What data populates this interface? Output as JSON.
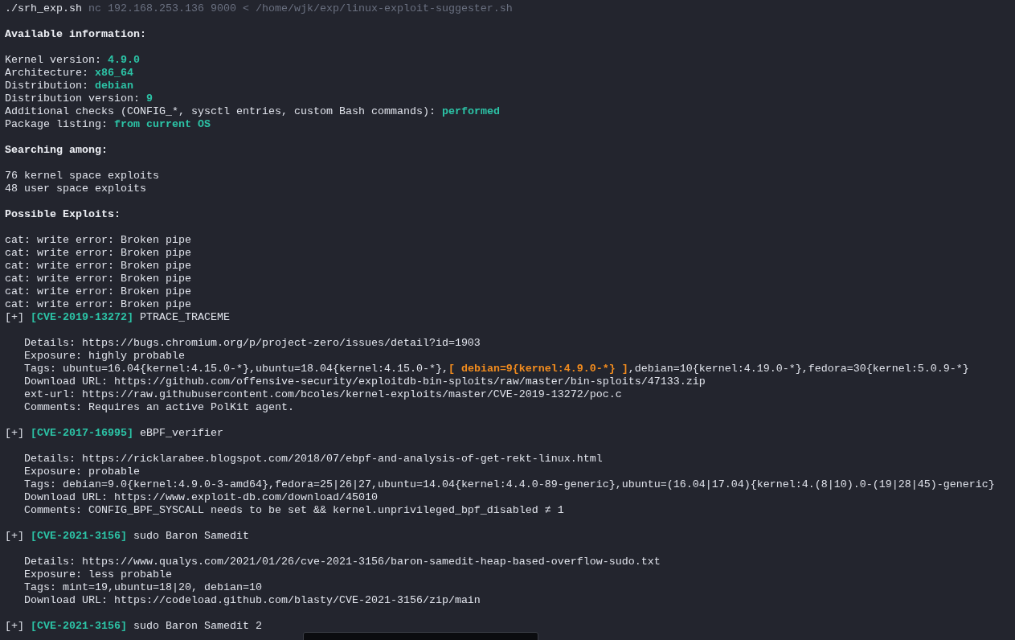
{
  "terminal": {
    "lines": [
      {
        "kind": "text",
        "segments": [
          {
            "kind": "plain",
            "text": "./srh_exp.sh"
          },
          {
            "kind": "ghost",
            "text": " nc 192.168.253.136 9000 < /home/wjk/exp/linux-exploit-suggester.sh"
          }
        ]
      },
      {
        "kind": "blank"
      },
      {
        "kind": "text",
        "segments": [
          {
            "kind": "bold",
            "text": "Available information:"
          }
        ]
      },
      {
        "kind": "blank"
      },
      {
        "kind": "text",
        "segments": [
          {
            "kind": "plain",
            "text": "Kernel version: "
          },
          {
            "kind": "accent",
            "text": "4.9.0"
          }
        ]
      },
      {
        "kind": "text",
        "segments": [
          {
            "kind": "plain",
            "text": "Architecture: "
          },
          {
            "kind": "accent",
            "text": "x86_64"
          }
        ]
      },
      {
        "kind": "text",
        "segments": [
          {
            "kind": "plain",
            "text": "Distribution: "
          },
          {
            "kind": "accent",
            "text": "debian"
          }
        ]
      },
      {
        "kind": "text",
        "segments": [
          {
            "kind": "plain",
            "text": "Distribution version: "
          },
          {
            "kind": "accent",
            "text": "9"
          }
        ]
      },
      {
        "kind": "text",
        "segments": [
          {
            "kind": "plain",
            "text": "Additional checks (CONFIG_*, sysctl entries, custom Bash commands): "
          },
          {
            "kind": "accent",
            "text": "performed"
          }
        ]
      },
      {
        "kind": "text",
        "segments": [
          {
            "kind": "plain",
            "text": "Package listing: "
          },
          {
            "kind": "accent",
            "text": "from current OS"
          }
        ]
      },
      {
        "kind": "blank"
      },
      {
        "kind": "text",
        "segments": [
          {
            "kind": "bold",
            "text": "Searching among:"
          }
        ]
      },
      {
        "kind": "blank"
      },
      {
        "kind": "text",
        "segments": [
          {
            "kind": "plain",
            "text": "76 kernel space exploits"
          }
        ]
      },
      {
        "kind": "text",
        "segments": [
          {
            "kind": "plain",
            "text": "48 user space exploits"
          }
        ]
      },
      {
        "kind": "blank"
      },
      {
        "kind": "text",
        "segments": [
          {
            "kind": "bold",
            "text": "Possible Exploits:"
          }
        ]
      },
      {
        "kind": "blank"
      },
      {
        "kind": "text",
        "segments": [
          {
            "kind": "plain",
            "text": "cat: write error: Broken pipe"
          }
        ]
      },
      {
        "kind": "text",
        "segments": [
          {
            "kind": "plain",
            "text": "cat: write error: Broken pipe"
          }
        ]
      },
      {
        "kind": "text",
        "segments": [
          {
            "kind": "plain",
            "text": "cat: write error: Broken pipe"
          }
        ]
      },
      {
        "kind": "text",
        "segments": [
          {
            "kind": "plain",
            "text": "cat: write error: Broken pipe"
          }
        ]
      },
      {
        "kind": "text",
        "segments": [
          {
            "kind": "plain",
            "text": "cat: write error: Broken pipe"
          }
        ]
      },
      {
        "kind": "text",
        "segments": [
          {
            "kind": "plain",
            "text": "cat: write error: Broken pipe"
          }
        ]
      },
      {
        "kind": "text",
        "segments": [
          {
            "kind": "plain",
            "text": "[+] "
          },
          {
            "kind": "accent",
            "text": "[CVE-2019-13272]"
          },
          {
            "kind": "plain",
            "text": " PTRACE_TRACEME"
          }
        ]
      },
      {
        "kind": "blank"
      },
      {
        "kind": "detail",
        "segments": [
          {
            "kind": "plain",
            "text": "Details: https://bugs.chromium.org/p/project-zero/issues/detail?id=1903"
          }
        ]
      },
      {
        "kind": "detail",
        "segments": [
          {
            "kind": "plain",
            "text": "Exposure: highly probable"
          }
        ]
      },
      {
        "kind": "detail",
        "segments": [
          {
            "kind": "plain",
            "text": "Tags: ubuntu=16.04{kernel:4.15.0-*},ubuntu=18.04{kernel:4.15.0-*},"
          },
          {
            "kind": "warn",
            "text": "[ debian=9{kernel:4.9.0-*} ]"
          },
          {
            "kind": "plain",
            "text": ",debian=10{kernel:4.19.0-*},fedora=30{kernel:5.0.9-*}"
          }
        ]
      },
      {
        "kind": "detail",
        "segments": [
          {
            "kind": "plain",
            "text": "Download URL: https://github.com/offensive-security/exploitdb-bin-sploits/raw/master/bin-sploits/47133.zip"
          }
        ]
      },
      {
        "kind": "detail",
        "segments": [
          {
            "kind": "plain",
            "text": "ext-url: https://raw.githubusercontent.com/bcoles/kernel-exploits/master/CVE-2019-13272/poc.c"
          }
        ]
      },
      {
        "kind": "detail",
        "segments": [
          {
            "kind": "plain",
            "text": "Comments: Requires an active PolKit agent."
          }
        ]
      },
      {
        "kind": "blank"
      },
      {
        "kind": "text",
        "segments": [
          {
            "kind": "plain",
            "text": "[+] "
          },
          {
            "kind": "accent",
            "text": "[CVE-2017-16995]"
          },
          {
            "kind": "plain",
            "text": " eBPF_verifier"
          }
        ]
      },
      {
        "kind": "blank"
      },
      {
        "kind": "detail",
        "segments": [
          {
            "kind": "plain",
            "text": "Details: https://ricklarabee.blogspot.com/2018/07/ebpf-and-analysis-of-get-rekt-linux.html"
          }
        ]
      },
      {
        "kind": "detail",
        "segments": [
          {
            "kind": "plain",
            "text": "Exposure: probable"
          }
        ]
      },
      {
        "kind": "detail",
        "segments": [
          {
            "kind": "plain",
            "text": "Tags: debian=9.0{kernel:4.9.0-3-amd64},fedora=25|26|27,ubuntu=14.04{kernel:4.4.0-89-generic},ubuntu=(16.04|17.04){kernel:4.(8|10).0-(19|28|45)-generic}"
          }
        ]
      },
      {
        "kind": "detail",
        "segments": [
          {
            "kind": "plain",
            "text": "Download URL: https://www.exploit-db.com/download/45010"
          }
        ]
      },
      {
        "kind": "detail",
        "segments": [
          {
            "kind": "plain",
            "text": "Comments: CONFIG_BPF_SYSCALL needs to be set && kernel.unprivileged_bpf_disabled ≠ 1"
          }
        ]
      },
      {
        "kind": "blank"
      },
      {
        "kind": "text",
        "segments": [
          {
            "kind": "plain",
            "text": "[+] "
          },
          {
            "kind": "accent",
            "text": "[CVE-2021-3156]"
          },
          {
            "kind": "plain",
            "text": " sudo Baron Samedit"
          }
        ]
      },
      {
        "kind": "blank"
      },
      {
        "kind": "detail",
        "segments": [
          {
            "kind": "plain",
            "text": "Details: https://www.qualys.com/2021/01/26/cve-2021-3156/baron-samedit-heap-based-overflow-sudo.txt"
          }
        ]
      },
      {
        "kind": "detail",
        "segments": [
          {
            "kind": "plain",
            "text": "Exposure: less probable"
          }
        ]
      },
      {
        "kind": "detail",
        "segments": [
          {
            "kind": "plain",
            "text": "Tags: mint=19,ubuntu=18|20, debian=10"
          }
        ]
      },
      {
        "kind": "detail",
        "segments": [
          {
            "kind": "plain",
            "text": "Download URL: https://codeload.github.com/blasty/CVE-2021-3156/zip/main"
          }
        ]
      },
      {
        "kind": "blank"
      },
      {
        "kind": "text",
        "segments": [
          {
            "kind": "plain",
            "text": "[+] "
          },
          {
            "kind": "accent",
            "text": "[CVE-2021-3156]"
          },
          {
            "kind": "plain",
            "text": " sudo Baron Samedit 2"
          }
        ]
      }
    ]
  }
}
